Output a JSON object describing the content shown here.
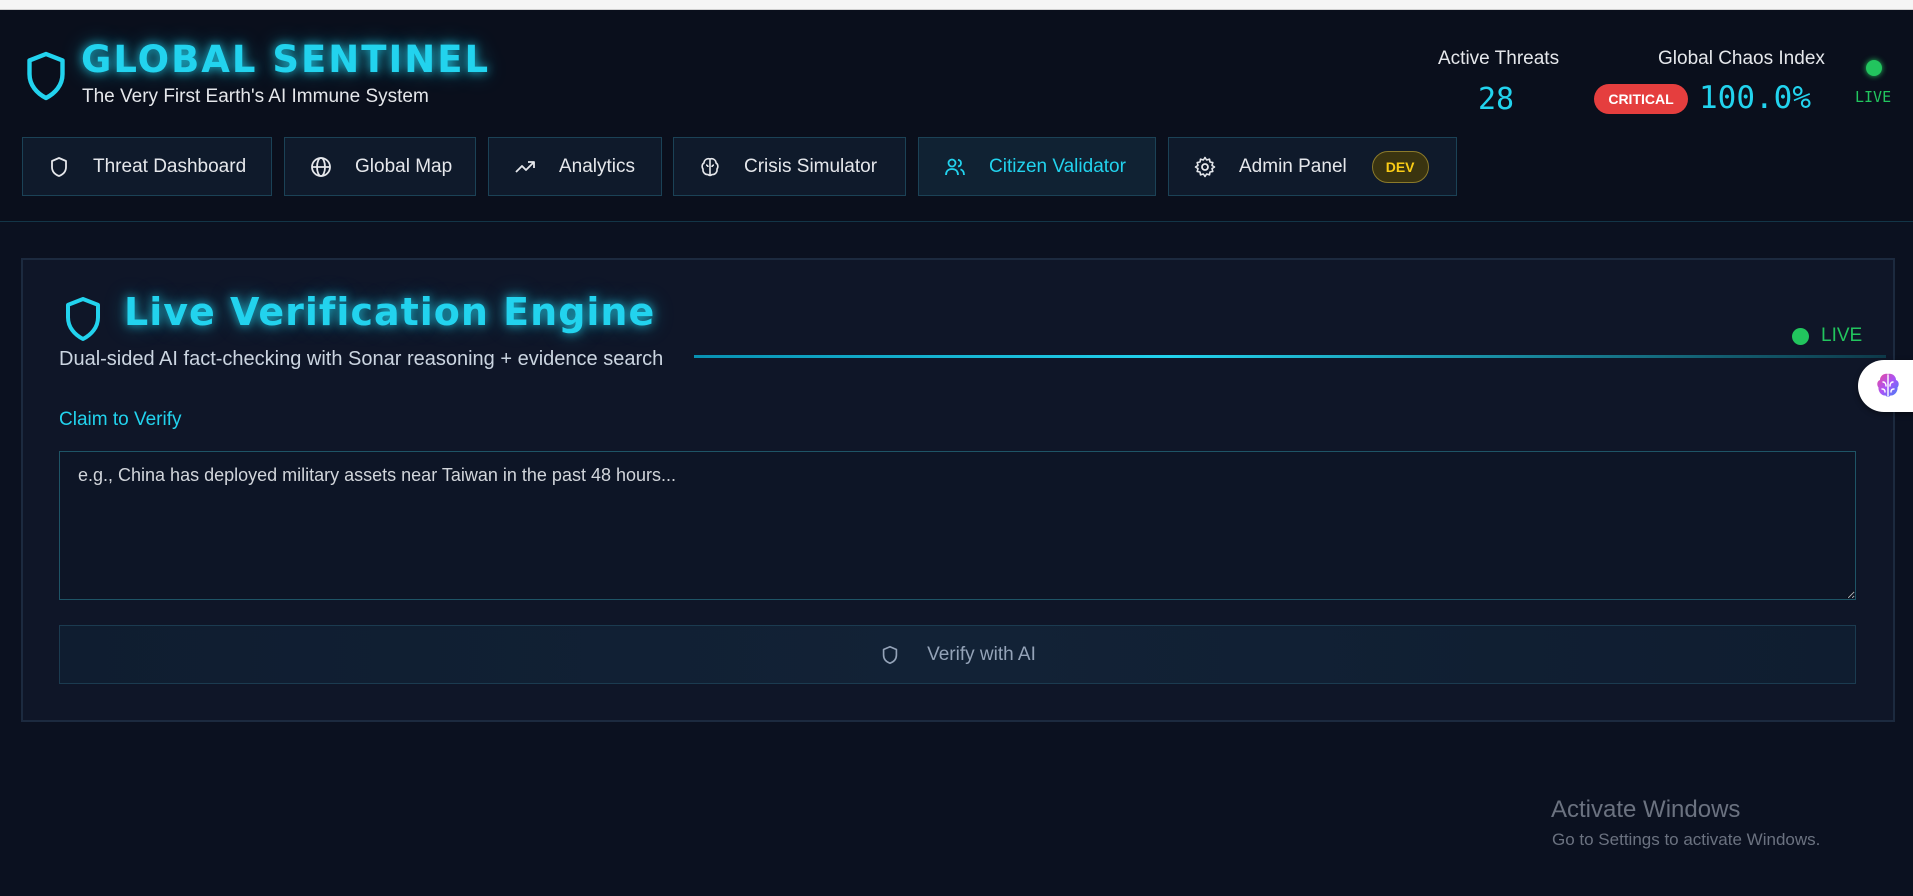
{
  "app": {
    "title": "GLOBAL SENTINEL",
    "subtitle": "The Very First Earth's AI Immune System"
  },
  "stats": {
    "active_threats_label": "Active Threats",
    "active_threats_value": "28",
    "chaos_label": "Global Chaos Index",
    "chaos_status": "CRITICAL",
    "chaos_value": "100.0%",
    "live_label": "LIVE"
  },
  "nav": {
    "tabs": [
      {
        "label": "Threat Dashboard",
        "icon": "shield-icon"
      },
      {
        "label": "Global Map",
        "icon": "globe-icon"
      },
      {
        "label": "Analytics",
        "icon": "trending-up-icon"
      },
      {
        "label": "Crisis Simulator",
        "icon": "brain-icon"
      },
      {
        "label": "Citizen Validator",
        "icon": "users-icon",
        "active": true
      },
      {
        "label": "Admin Panel",
        "icon": "gear-icon",
        "badge": "DEV"
      }
    ]
  },
  "engine": {
    "title": "Live Verification Engine",
    "subtitle": "Dual-sided AI fact-checking with Sonar reasoning + evidence search",
    "live_label": "LIVE",
    "claim_label": "Claim to Verify",
    "claim_placeholder": "e.g., China has deployed military assets near Taiwan in the past 48 hours...",
    "claim_value": "",
    "verify_button": "Verify with AI"
  },
  "windows_watermark": {
    "title": "Activate Windows",
    "subtitle": "Go to Settings to activate Windows."
  },
  "colors": {
    "accent": "#22d3ee",
    "live": "#22c55e",
    "critical": "#e53e3e",
    "dev_badge": "#facc15",
    "background": "#0b1120"
  }
}
